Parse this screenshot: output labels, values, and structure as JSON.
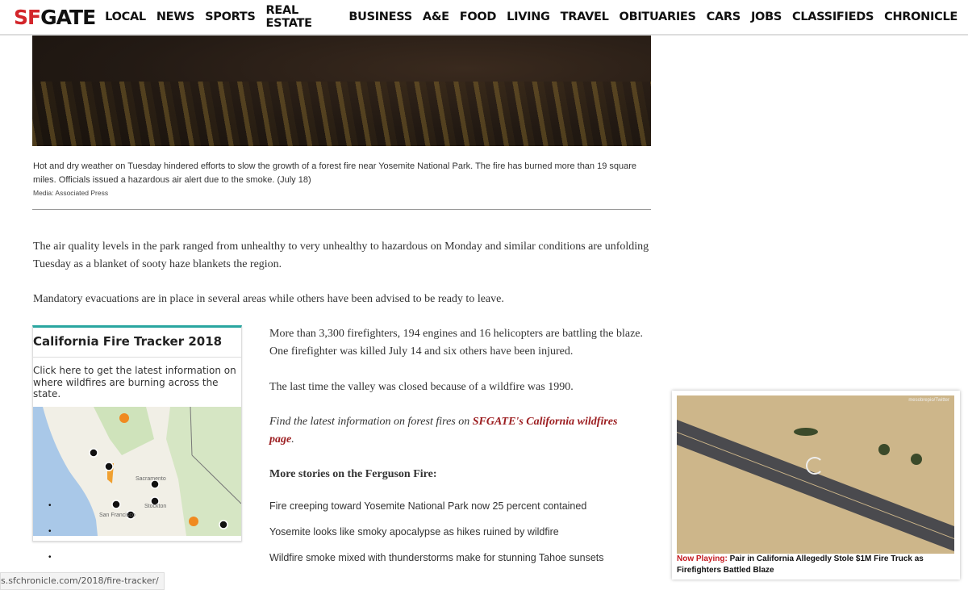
{
  "nav": {
    "logo_sf": "SF",
    "logo_gate": "GATE",
    "items": [
      "LOCAL",
      "NEWS",
      "SPORTS",
      "REAL ESTATE",
      "BUSINESS",
      "A&E",
      "FOOD",
      "LIVING",
      "TRAVEL",
      "OBITUARIES",
      "CARS",
      "JOBS",
      "CLASSIFIEDS",
      "CHRONICLE"
    ]
  },
  "hero": {
    "caption": "Hot and dry weather on Tuesday hindered efforts to slow the growth of a forest fire near Yosemite National Park. The fire has burned more than 19 square miles. Officials issued a hazardous air alert due to the smoke. (July 18)",
    "media": "Media: Associated Press"
  },
  "article": {
    "p1": "The air quality levels in the park ranged from unhealthy to very unhealthy to hazardous on Monday and similar conditions are unfolding Tuesday as a blanket of sooty haze blankets the region.",
    "p2": "Mandatory evacuations are in place in several areas while others have been advised to be ready to leave.",
    "p3": "More than 3,300 firefighters, 194 engines and 16 helicopters are battling the blaze. One firefighter was killed July 14 and six others have been injured.",
    "p4": "The last time the valley was closed because of a wildfire was 1990.",
    "p5_prefix": "Find the latest information on forest fires on ",
    "p5_link": "SFGATE's California wildfires page",
    "p5_suffix": ".",
    "more_heading": "More stories on the Ferguson Fire:",
    "stories": [
      "Fire creeping toward Yosemite National Park now 25 percent contained",
      "Yosemite looks like smoky apocalypse as hikes ruined by wildfire",
      "Wildfire smoke mixed with thunderstorms make for stunning Tahoe sunsets"
    ]
  },
  "widget": {
    "title": "California Fire Tracker 2018",
    "desc": "Click here to get the latest information on where wildfires are burning across the state.",
    "map_labels": [
      "Sacramento",
      "Stockton",
      "San Francisco"
    ]
  },
  "video": {
    "now_playing": "Now Playing:",
    "title": " Pair in California Allegedly Stole $1M Fire Truck as Firefighters Battled Blaze",
    "credit": "mesobrepio/Twitter"
  },
  "status": {
    "url": "s.sfchronicle.com/2018/fire-tracker/"
  },
  "colors": {
    "brand_red": "#d3262b",
    "link_red": "#9b1c1f",
    "tracker_teal": "#2aa6a0"
  }
}
